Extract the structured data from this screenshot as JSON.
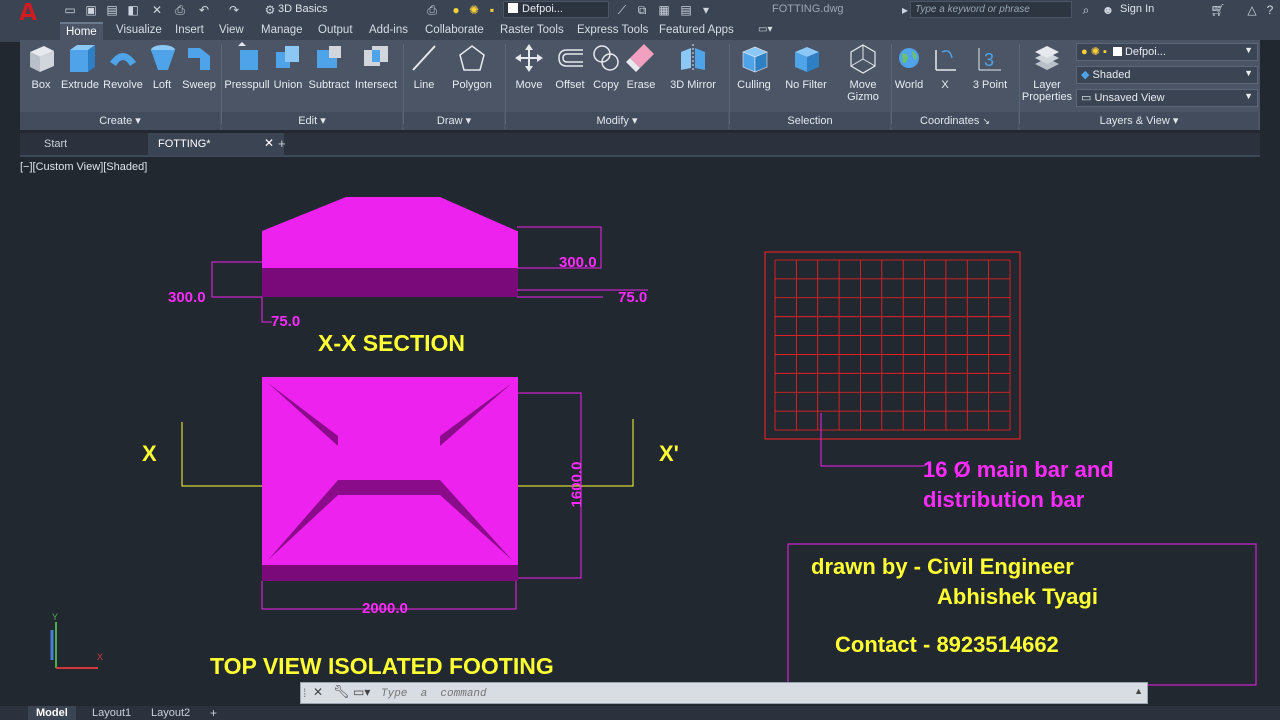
{
  "app": {
    "logo_letter": "A",
    "workspace": "3D Basics",
    "layer_combo": "Defpoi...",
    "file_title": "FOTTING.dwg",
    "search_placeholder": "Type a keyword or phrase",
    "sign_in": "Sign In"
  },
  "ribbon_tabs": [
    "Home",
    "Visualize",
    "Insert",
    "View",
    "Manage",
    "Output",
    "Add-ins",
    "Collaborate",
    "Raster Tools",
    "Express Tools",
    "Featured Apps"
  ],
  "ribbon": {
    "create": {
      "title": "Create",
      "buttons": [
        "Box",
        "Extrude",
        "Revolve",
        "Loft",
        "Sweep"
      ]
    },
    "edit": {
      "title": "Edit",
      "buttons": [
        "Presspull",
        "Union",
        "Subtract",
        "Intersect"
      ]
    },
    "draw": {
      "title": "Draw",
      "buttons": [
        "Line",
        "Polygon"
      ]
    },
    "modify": {
      "title": "Modify",
      "buttons": [
        "Move",
        "Offset",
        "Copy",
        "Erase",
        "3D Mirror"
      ]
    },
    "selection": {
      "title": "Selection",
      "buttons": [
        "Culling",
        "No Filter",
        "Move",
        "Gizmo"
      ]
    },
    "coordinates": {
      "title": "Coordinates",
      "buttons": [
        "World",
        "X",
        "3 Point"
      ]
    },
    "layers": {
      "title": "Layers & View",
      "layer_properties_line1": "Layer",
      "layer_properties_line2": "Properties",
      "layer_name": "Defpoi...",
      "visual_style": "Shaded",
      "named_view": "Unsaved View"
    }
  },
  "doc_tabs": {
    "start": "Start",
    "active": "FOTTING*"
  },
  "viewport_label": "[−][Custom View][Shaded]",
  "drawing": {
    "section_title": "X-X SECTION",
    "dim_300_left": "300.0",
    "dim_300_right": "300.0",
    "dim_75_left": "75.0",
    "dim_75_right": "75.0",
    "dim_1600": "1600.0",
    "dim_2000": "2000.0",
    "marker_x": "X",
    "marker_x_prime": "X'",
    "top_view_title": "TOP VIEW  ISOLATED FOOTING",
    "bar_note_line1": "16 Ø main bar and",
    "bar_note_line2": "distribution bar",
    "credit_line1": "drawn by - Civil Engineer",
    "credit_line2": "Abhishek Tyagi",
    "contact": "Contact - 8923514662",
    "ucs_y": "Y",
    "ucs_x": "X"
  },
  "command_line": {
    "placeholder": "Type  a  command"
  },
  "layout_tabs": [
    "Model",
    "Layout1",
    "Layout2"
  ],
  "colors": {
    "model_space": "#212830",
    "footing": "#ee22ee",
    "footing_dark": "#7a0a7a",
    "rebar": "#ff2020",
    "dim_text": "#ff2bff",
    "title_text": "#ffff33",
    "autocad_red": "#d61a1f"
  }
}
